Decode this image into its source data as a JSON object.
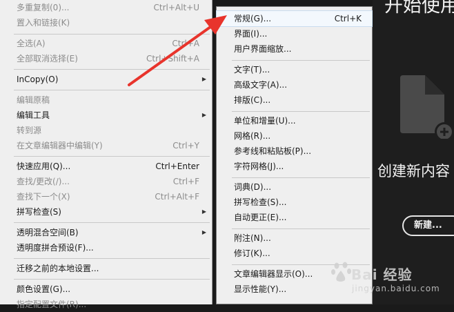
{
  "left_menu": {
    "items": [
      {
        "label": "多重复制(0)...",
        "shortcut": "Ctrl+Alt+U",
        "disabled": true
      },
      {
        "label": "置入和链接(K)",
        "shortcut": "",
        "disabled": true
      },
      {
        "label": "全选(A)",
        "shortcut": "Ctrl+A",
        "disabled": true
      },
      {
        "label": "全部取消选择(E)",
        "shortcut": "Ctrl+Shift+A",
        "disabled": true
      },
      {
        "label": "InCopy(O)",
        "shortcut": "",
        "disabled": false,
        "submenu": true
      },
      {
        "label": "编辑原稿",
        "shortcut": "",
        "disabled": true
      },
      {
        "label": "编辑工具",
        "shortcut": "",
        "disabled": false,
        "submenu": true
      },
      {
        "label": "转到源",
        "shortcut": "",
        "disabled": true
      },
      {
        "label": "在文章编辑器中编辑(Y)",
        "shortcut": "Ctrl+Y",
        "disabled": true
      },
      {
        "label": "快速应用(Q)...",
        "shortcut": "Ctrl+Enter",
        "disabled": false
      },
      {
        "label": "查找/更改(/)...",
        "shortcut": "Ctrl+F",
        "disabled": true
      },
      {
        "label": "查找下一个(X)",
        "shortcut": "Ctrl+Alt+F",
        "disabled": true
      },
      {
        "label": "拼写检查(S)",
        "shortcut": "",
        "disabled": false,
        "submenu": true
      },
      {
        "label": "透明混合空间(B)",
        "shortcut": "",
        "disabled": false,
        "submenu": true
      },
      {
        "label": "透明度拼合预设(F)...",
        "shortcut": "",
        "disabled": false
      },
      {
        "label": "迁移之前的本地设置...",
        "shortcut": "",
        "disabled": false
      },
      {
        "label": "颜色设置(G)...",
        "shortcut": "",
        "disabled": false
      },
      {
        "label": "指定配置文件(R)...",
        "shortcut": "",
        "disabled": true
      }
    ]
  },
  "right_menu": {
    "items": [
      {
        "label": "常规(G)...",
        "shortcut": "Ctrl+K",
        "highlighted": true
      },
      {
        "label": "界面(I)...",
        "shortcut": ""
      },
      {
        "label": "用户界面缩放...",
        "shortcut": ""
      },
      {
        "label": "文字(T)...",
        "shortcut": ""
      },
      {
        "label": "高级文字(A)...",
        "shortcut": ""
      },
      {
        "label": "排版(C)...",
        "shortcut": ""
      },
      {
        "label": "单位和增量(U)...",
        "shortcut": ""
      },
      {
        "label": "网格(R)...",
        "shortcut": ""
      },
      {
        "label": "参考线和粘贴板(P)...",
        "shortcut": ""
      },
      {
        "label": "字符网格(J)...",
        "shortcut": ""
      },
      {
        "label": "词典(D)...",
        "shortcut": ""
      },
      {
        "label": "拼写检查(S)...",
        "shortcut": ""
      },
      {
        "label": "自动更正(E)...",
        "shortcut": ""
      },
      {
        "label": "附注(N)...",
        "shortcut": ""
      },
      {
        "label": "修订(K)...",
        "shortcut": ""
      },
      {
        "label": "文章编辑器显示(O)...",
        "shortcut": ""
      },
      {
        "label": "显示性能(Y)...",
        "shortcut": ""
      }
    ]
  },
  "start_panel": {
    "title": "开始使用",
    "create_text": "创建新内容",
    "new_button": "新建..."
  },
  "watermark": {
    "brand": "Bai 经验",
    "site": "jingyan.baidu.com"
  },
  "colors": {
    "menu_bg": "#efefef",
    "panel_bg": "#1e1e1e",
    "arrow": "#e8342c",
    "disabled_text": "#8c8c8c"
  }
}
